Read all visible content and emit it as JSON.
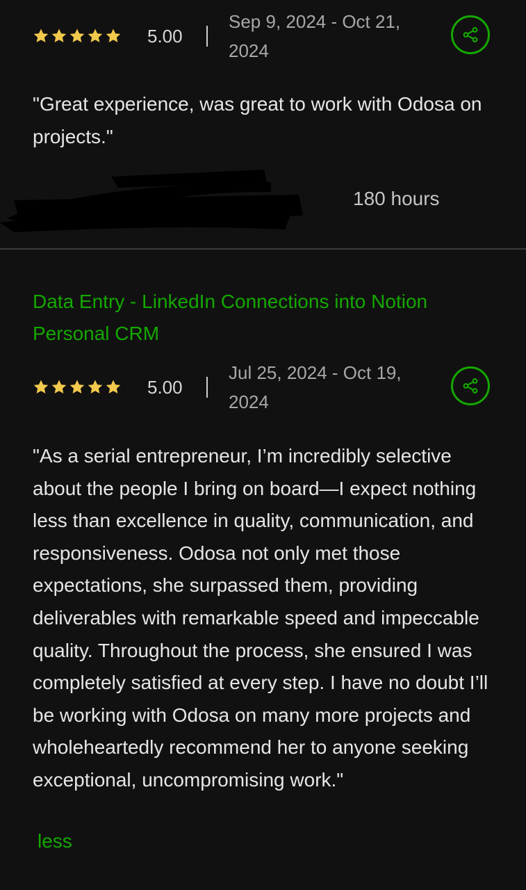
{
  "colors": {
    "background": "#111111",
    "accent": "#14a800",
    "star": "#f2c94c",
    "divider": "#3a3a3a"
  },
  "reviews": [
    {
      "rating": 5,
      "score": "5.00",
      "dates": "Sep 9, 2024 - Oct 21, 2024",
      "share_icon": "share-icon",
      "quote": "\"Great experience, was great to work with Odosa on projects.\"",
      "hours": "180 hours"
    },
    {
      "title": "Data Entry - LinkedIn Connections into Notion Personal CRM",
      "rating": 5,
      "score": "5.00",
      "dates": "Jul 25, 2024 - Oct 19, 2024",
      "share_icon": "share-icon",
      "quote": "\"As a serial entrepreneur, I’m incredibly selective about the people I bring on board—I expect nothing less than excellence in quality, communication, and responsiveness. Odosa not only met those expectations, she surpassed them, providing deliverables with remarkable speed and impeccable quality. Throughout the process, she ensured I was completely satisfied at every step. I have no doubt I’ll be working with Odosa on many more projects and wholeheartedly recommend her to anyone seeking exceptional, uncompromising work.\"",
      "less_link": "less"
    }
  ]
}
